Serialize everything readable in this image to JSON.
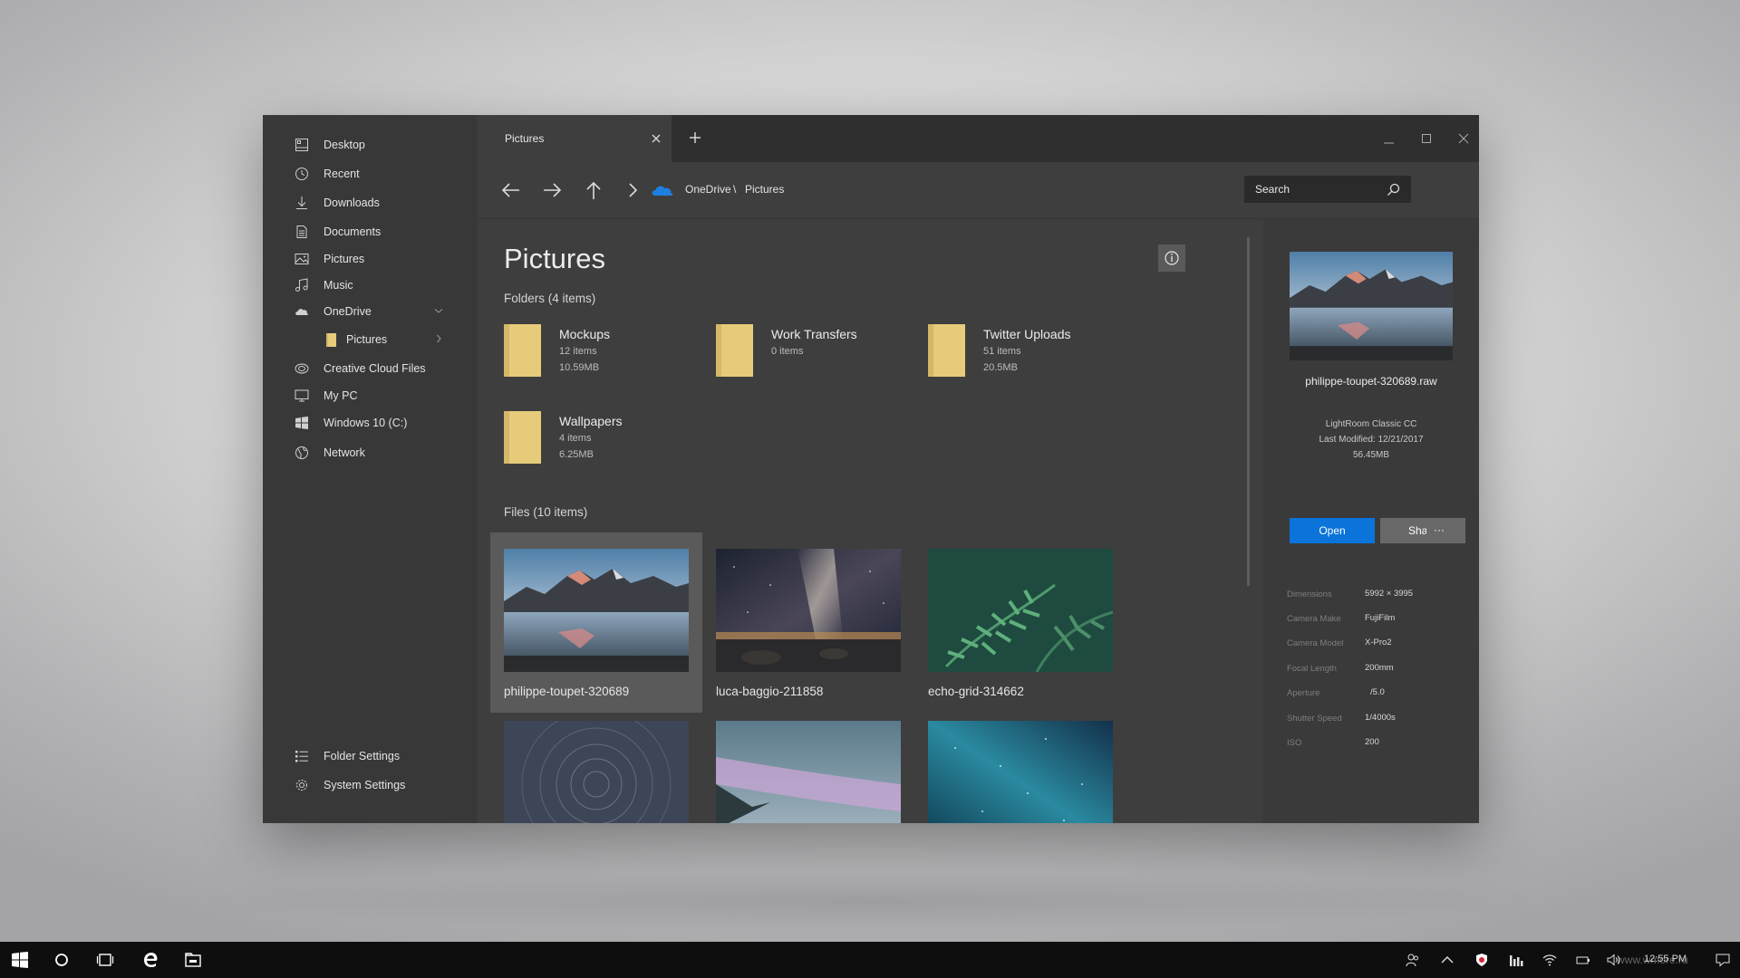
{
  "colors": {
    "accent": "#0a74da",
    "folder": "#e6cb7a",
    "window_bg": "#3e3e3e",
    "sidebar_bg": "#383838",
    "taskbar_bg": "#0e0e0e"
  },
  "sidebar": {
    "items": [
      {
        "label": "Desktop",
        "icon": "desktop-icon"
      },
      {
        "label": "Recent",
        "icon": "clock-icon"
      },
      {
        "label": "Downloads",
        "icon": "download-icon"
      },
      {
        "label": "Documents",
        "icon": "document-icon"
      },
      {
        "label": "Pictures",
        "icon": "image-icon"
      },
      {
        "label": "Music",
        "icon": "music-icon"
      },
      {
        "label": "OneDrive",
        "icon": "cloud-icon"
      },
      {
        "label": "Pictures",
        "icon": "folder-icon"
      },
      {
        "label": "Creative Cloud Files",
        "icon": "creative-cloud-icon"
      },
      {
        "label": "My PC",
        "icon": "monitor-icon"
      },
      {
        "label": "Windows 10 (C:)",
        "icon": "windows-icon"
      },
      {
        "label": "Network",
        "icon": "globe-icon"
      }
    ],
    "footer": [
      {
        "label": "Folder Settings",
        "icon": "list-icon"
      },
      {
        "label": "System Settings",
        "icon": "gear-icon"
      }
    ]
  },
  "tabs": [
    {
      "label": "Pictures"
    }
  ],
  "breadcrumb": {
    "root": "OneDrive",
    "separator": "\\",
    "current": "Pictures"
  },
  "search": {
    "placeholder": "Search"
  },
  "main": {
    "title": "Pictures",
    "folders_heading": "Folders (4 items)",
    "files_heading": "Files (10 items)",
    "folders": [
      {
        "name": "Mockups",
        "items": "12 items",
        "size": "10.59MB"
      },
      {
        "name": "Work Transfers",
        "items": "0 items",
        "size": ""
      },
      {
        "name": "Twitter Uploads",
        "items": "51 items",
        "size": "20.5MB"
      },
      {
        "name": "Wallpapers",
        "items": "4 items",
        "size": "6.25MB"
      }
    ],
    "files": [
      {
        "name": "philippe-toupet-320689",
        "selected": true
      },
      {
        "name": "luca-baggio-211858",
        "selected": false
      },
      {
        "name": "echo-grid-314662",
        "selected": false
      },
      {
        "name": "",
        "selected": false
      },
      {
        "name": "",
        "selected": false
      },
      {
        "name": "",
        "selected": false
      }
    ]
  },
  "details": {
    "filename": "philippe-toupet-320689.raw",
    "app": "LightRoom Classic CC",
    "modified": "Last Modified: 12/21/2017",
    "size": "56.45MB",
    "open_label": "Open",
    "share_label": "Share",
    "more_label": "···",
    "properties": [
      {
        "key": "Dimensions",
        "value": "5992 × 3995"
      },
      {
        "key": "Camera Make",
        "value": "FujiFilm"
      },
      {
        "key": "Camera Model",
        "value": "X-Pro2"
      },
      {
        "key": "Focal Length",
        "value": "200mm"
      },
      {
        "key": "Aperture",
        "value": "/5.0"
      },
      {
        "key": "Shutter Speed",
        "value": "1/4000s"
      },
      {
        "key": "ISO",
        "value": "200"
      }
    ]
  },
  "taskbar": {
    "clock": "12:55 PM",
    "watermark": "www.wmore.ru"
  }
}
